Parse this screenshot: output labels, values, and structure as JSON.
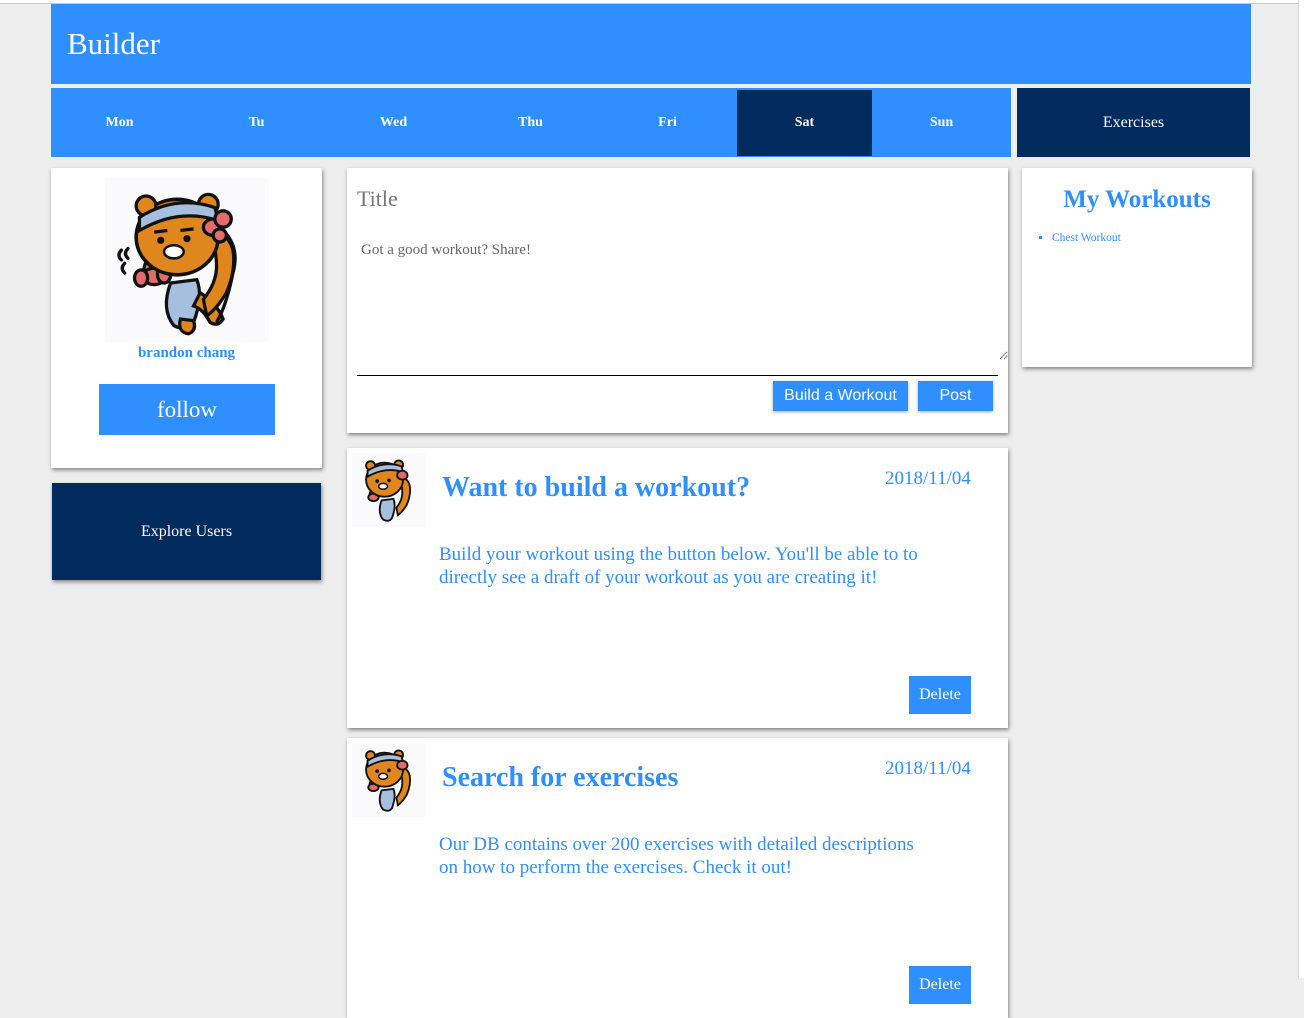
{
  "app": {
    "title": "Builder"
  },
  "days": [
    {
      "label": "Mon",
      "active": false
    },
    {
      "label": "Tu",
      "active": false
    },
    {
      "label": "Wed",
      "active": false
    },
    {
      "label": "Thu",
      "active": false
    },
    {
      "label": "Fri",
      "active": false
    },
    {
      "label": "Sat",
      "active": true
    },
    {
      "label": "Sun",
      "active": false
    }
  ],
  "nav": {
    "exercises_label": "Exercises"
  },
  "profile": {
    "username": "brandon chang",
    "follow_label": "follow",
    "avatar_icon": "bear-exercising-avatar"
  },
  "explore_label": "Explore Users",
  "composer": {
    "title_placeholder": "Title",
    "body_placeholder": "Got a good workout? Share!",
    "build_label": "Build a Workout",
    "post_label": "Post"
  },
  "my_workouts": {
    "title": "My Workouts",
    "items": [
      "Chest Workout"
    ]
  },
  "posts": [
    {
      "title": "Want to build a workout?",
      "date": "2018/11/04",
      "body": "Build your workout using the button below. You'll be able to to directly see a draft of your workout as you are creating it!",
      "delete_label": "Delete"
    },
    {
      "title": "Search for exercises",
      "date": "2018/11/04",
      "body": "Our DB contains over 200 exercises with detailed descriptions on how to perform the exercises. Check it out!",
      "delete_label": "Delete"
    }
  ],
  "colors": {
    "primary": "#2f8ffe",
    "dark": "#002b5c",
    "background": "#eeeeee"
  }
}
